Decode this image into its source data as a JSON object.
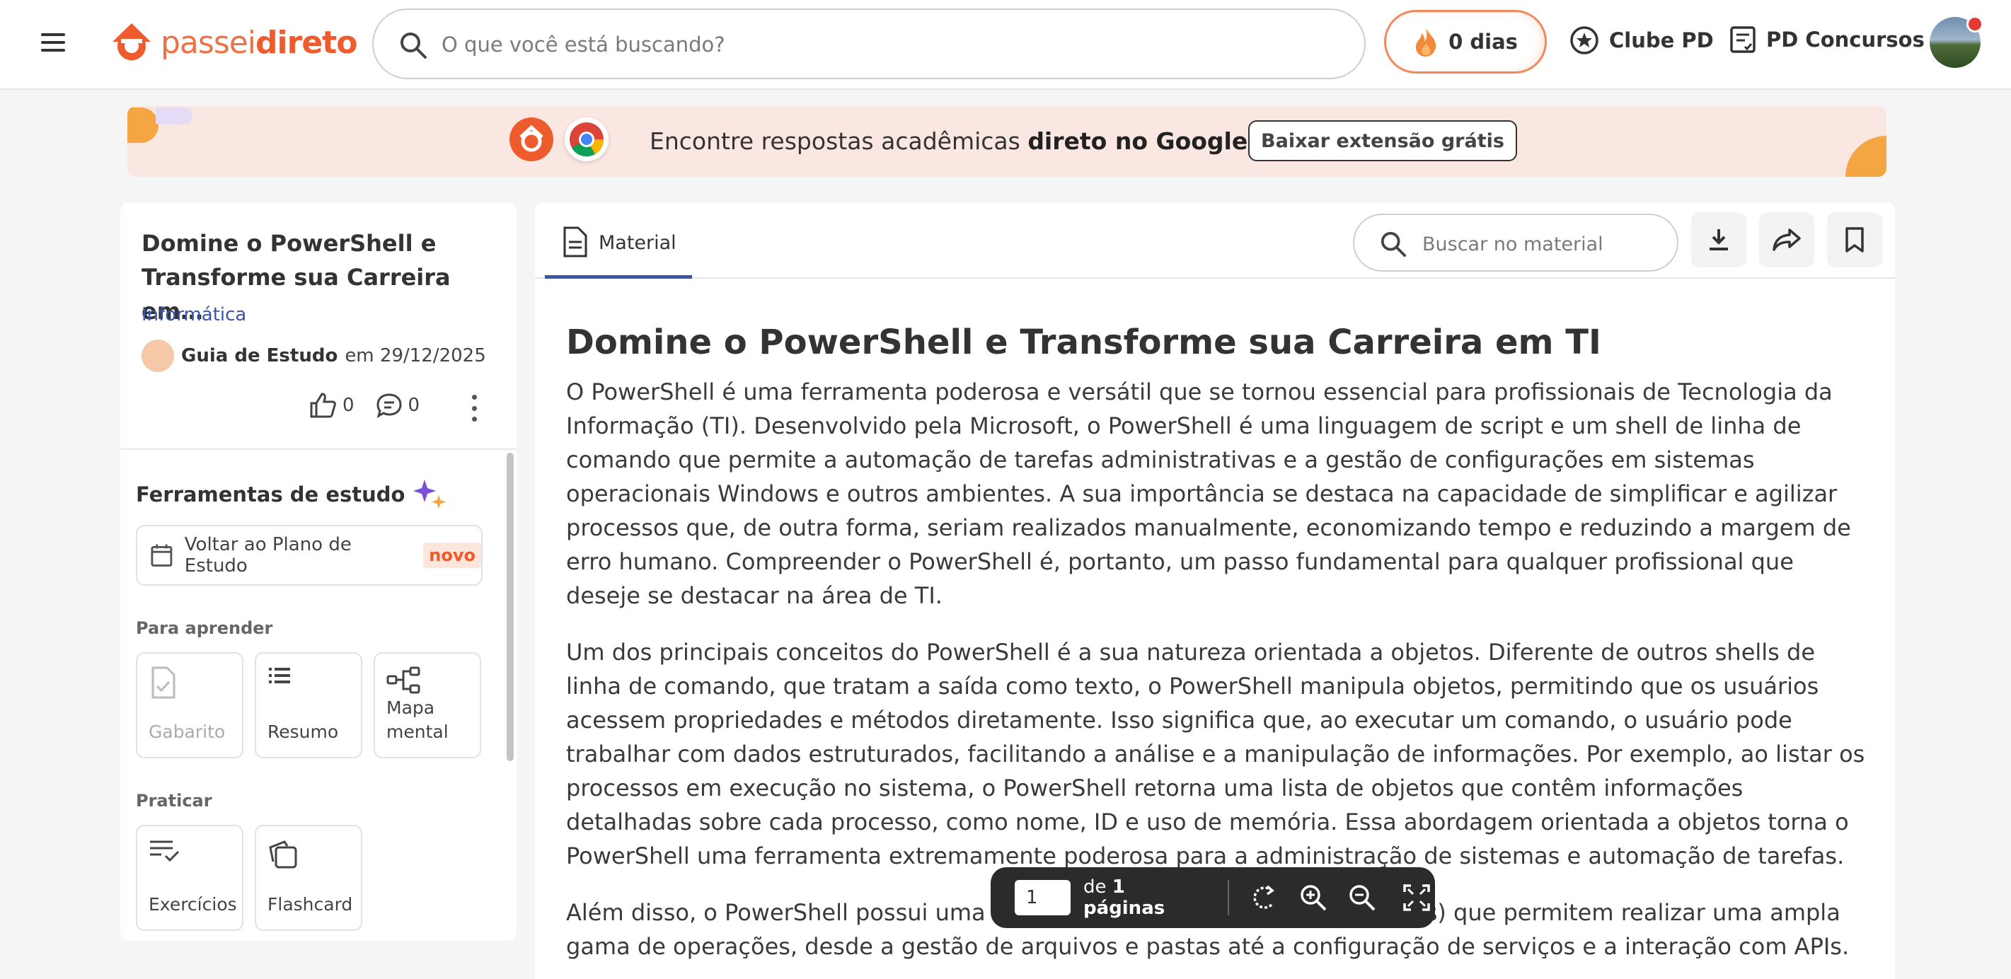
{
  "header": {
    "logo_light": "passei",
    "logo_bold": "direto",
    "search_placeholder": "O que você está buscando?",
    "streak_label": "0 dias",
    "nav": [
      {
        "label": "Clube PD",
        "icon": "star-badge-icon"
      },
      {
        "label": "PD Concursos",
        "icon": "checklist-icon"
      }
    ]
  },
  "banner": {
    "text_regular": "Encontre respostas acadêmicas ",
    "text_bold": "direto no Google!",
    "button_label": "Baixar extensão grátis"
  },
  "document": {
    "title": "Domine o PowerShell e Transforme sua Carreira em…",
    "category": "Informática",
    "author": "Guia de Estudo",
    "date": "em 29/12/2025",
    "likes": "0",
    "comments": "0"
  },
  "tools": {
    "title": "Ferramentas de estudo",
    "plan_button": "Voltar ao Plano de Estudo",
    "plan_badge": "novo",
    "learn_label": "Para aprender",
    "learn": [
      "Gabarito",
      "Resumo",
      "Mapa mental"
    ],
    "practice_label": "Praticar",
    "practice": [
      "Exercícios",
      "Flashcard"
    ]
  },
  "main": {
    "tab_label": "Material",
    "search_placeholder": "Buscar no material",
    "heading": "Domine o PowerShell e Transforme sua Carreira em TI",
    "paragraphs": [
      "O PowerShell é uma ferramenta poderosa e versátil que se tornou essencial para profissionais de Tecnologia da Informação (TI). Desenvolvido pela Microsoft, o PowerShell é uma linguagem de script e um shell de linha de comando que permite a automação de tarefas administrativas e a gestão de configurações em sistemas operacionais Windows e outros ambientes. A sua importância se destaca na capacidade de simplificar e agilizar processos que, de outra forma, seriam realizados manualmente, economizando tempo e reduzindo a margem de erro humano. Compreender o PowerShell é, portanto, um passo fundamental para qualquer profissional que deseje se destacar na área de TI.",
      "Um dos principais conceitos do PowerShell é a sua natureza orientada a objetos. Diferente de outros shells de linha de comando, que tratam a saída como texto, o PowerShell manipula objetos, permitindo que os usuários acessem propriedades e métodos diretamente. Isso significa que, ao executar um comando, o usuário pode trabalhar com dados estruturados, facilitando a análise e a manipulação de informações. Por exemplo, ao listar os processos em execução no sistema, o PowerShell retorna uma lista de objetos que contêm informações detalhadas sobre cada processo, como nome, ID e uso de memória. Essa abordagem orientada a objetos torna o PowerShell uma ferramenta extremamente poderosa para a administração de sistemas e automação de tarefas.",
      "Além disso, o PowerShell possui uma vasta biblioteca de cmdlets (comandos) que permitem realizar uma ampla gama de operações, desde a gestão de arquivos e pastas até a configuração de serviços e a interação com APIs."
    ]
  },
  "viewer": {
    "page_value": "1",
    "of_text": "de ",
    "pages_text": "1 páginas"
  },
  "colors": {
    "brand": "#ee5b2c",
    "link": "#3a56a8",
    "accent_purple": "#7b4fd6"
  }
}
